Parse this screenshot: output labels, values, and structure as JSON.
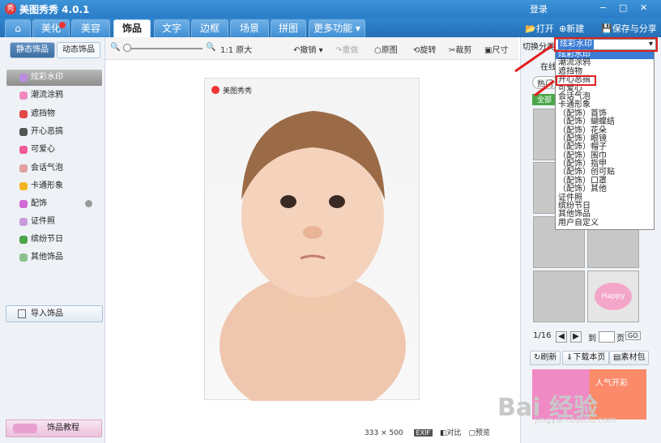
{
  "app": {
    "title": "美图秀秀 4.0.1",
    "logo": "秀",
    "login": "登录"
  },
  "window": {
    "ctrl": [
      "−",
      "□",
      "✕"
    ]
  },
  "nav": {
    "tabs": [
      "美化",
      "美容",
      "饰品",
      "文字",
      "边框",
      "场景",
      "拼图",
      "更多功能 ▾"
    ],
    "active": 2,
    "home_icon": "home-icon"
  },
  "top_actions": {
    "open": "打开",
    "new": "新建",
    "save": "保存与分享"
  },
  "toolbar": {
    "zoom": "1:1 原大",
    "undo": "撤销",
    "redo": "重做",
    "original": "原图",
    "rotate": "旋转",
    "crop": "裁剪",
    "size": "尺寸"
  },
  "sidebar": {
    "tabs": [
      "静态饰品",
      "动态饰品"
    ],
    "items": [
      "炫彩水印",
      "潮流涂鸦",
      "遮挡物",
      "开心恶搞",
      "可爱心",
      "会话气泡",
      "卡通形象",
      "配饰",
      "证件照",
      "缤纷节日",
      "其他饰品"
    ],
    "import": "导入饰品",
    "tutorial": "饰品教程"
  },
  "photo": {
    "watermark": "美图秀秀"
  },
  "status": {
    "w": "333",
    "x": "×",
    "h": "500",
    "exif": "EXIF",
    "compare": "对比",
    "preview": "预览"
  },
  "right": {
    "switch_label": "切换分类",
    "selected": "炫彩水印",
    "online": "在线",
    "hot": "热门",
    "all": "全部",
    "options": [
      "炫彩水印",
      "潮流涂鸦",
      "遮挡物",
      "开心恶搞",
      "可爱心",
      "会话气泡",
      "卡通形象",
      "（配饰）首饰",
      "（配饰）蝴蝶结",
      "（配饰）花朵",
      "（配饰）眼镜",
      "（配饰）帽子",
      "（配饰）围巾",
      "（配饰）指甲",
      "（配饰）创可贴",
      "（配饰）口罩",
      "（配饰）其他",
      "证件照",
      "缤纷节日",
      "其他饰品",
      "用户自定义"
    ],
    "page": "1/16",
    "to": "到",
    "page_unit": "页",
    "go": "GO",
    "refresh": "刷新",
    "download": "下载本页",
    "pack": "素材包",
    "banner_right": "人气开彩",
    "happy": "Happy"
  },
  "baidu": {
    "text": "Bai 经验",
    "url": "jingyan.baidu.com"
  },
  "colors": {
    "accent": "#2a7cc6",
    "highlight": "#e02020"
  }
}
